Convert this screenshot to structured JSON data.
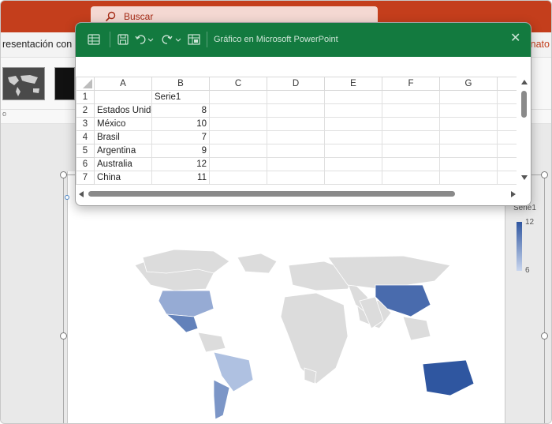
{
  "powerpoint": {
    "search_label": "Buscar",
    "ribbon_left_text": "resentación con c",
    "ribbon_right_text": "nato",
    "below_gallery_text": "o"
  },
  "excel_window": {
    "title": "Gráfico en Microsoft PowerPoint",
    "column_headers": [
      "A",
      "B",
      "C",
      "D",
      "E",
      "F",
      "G"
    ],
    "rows": [
      {
        "num": "1",
        "a": "",
        "b": "Serie1"
      },
      {
        "num": "2",
        "a": "Estados Unidos",
        "b": "8"
      },
      {
        "num": "3",
        "a": "México",
        "b": "10"
      },
      {
        "num": "4",
        "a": "Brasil",
        "b": "7"
      },
      {
        "num": "5",
        "a": "Argentina",
        "b": "9"
      },
      {
        "num": "6",
        "a": "Australia",
        "b": "12"
      },
      {
        "num": "7",
        "a": "China",
        "b": "11"
      }
    ]
  },
  "map_chart": {
    "legend_title": "Serie1",
    "legend_max": "12",
    "legend_min": "6",
    "colors": {
      "base": "#dcdcdc",
      "low": "#c3d1ea",
      "mid": "#8fa7d4",
      "high": "#2f56a0"
    }
  },
  "chart_data": {
    "type": "heatmap",
    "series": [
      {
        "name": "Serie1",
        "categories": [
          "Estados Unidos",
          "México",
          "Brasil",
          "Argentina",
          "Australia",
          "China"
        ],
        "values": [
          8,
          10,
          7,
          9,
          12,
          11
        ]
      }
    ],
    "scale": {
      "min": 6,
      "max": 12
    }
  }
}
